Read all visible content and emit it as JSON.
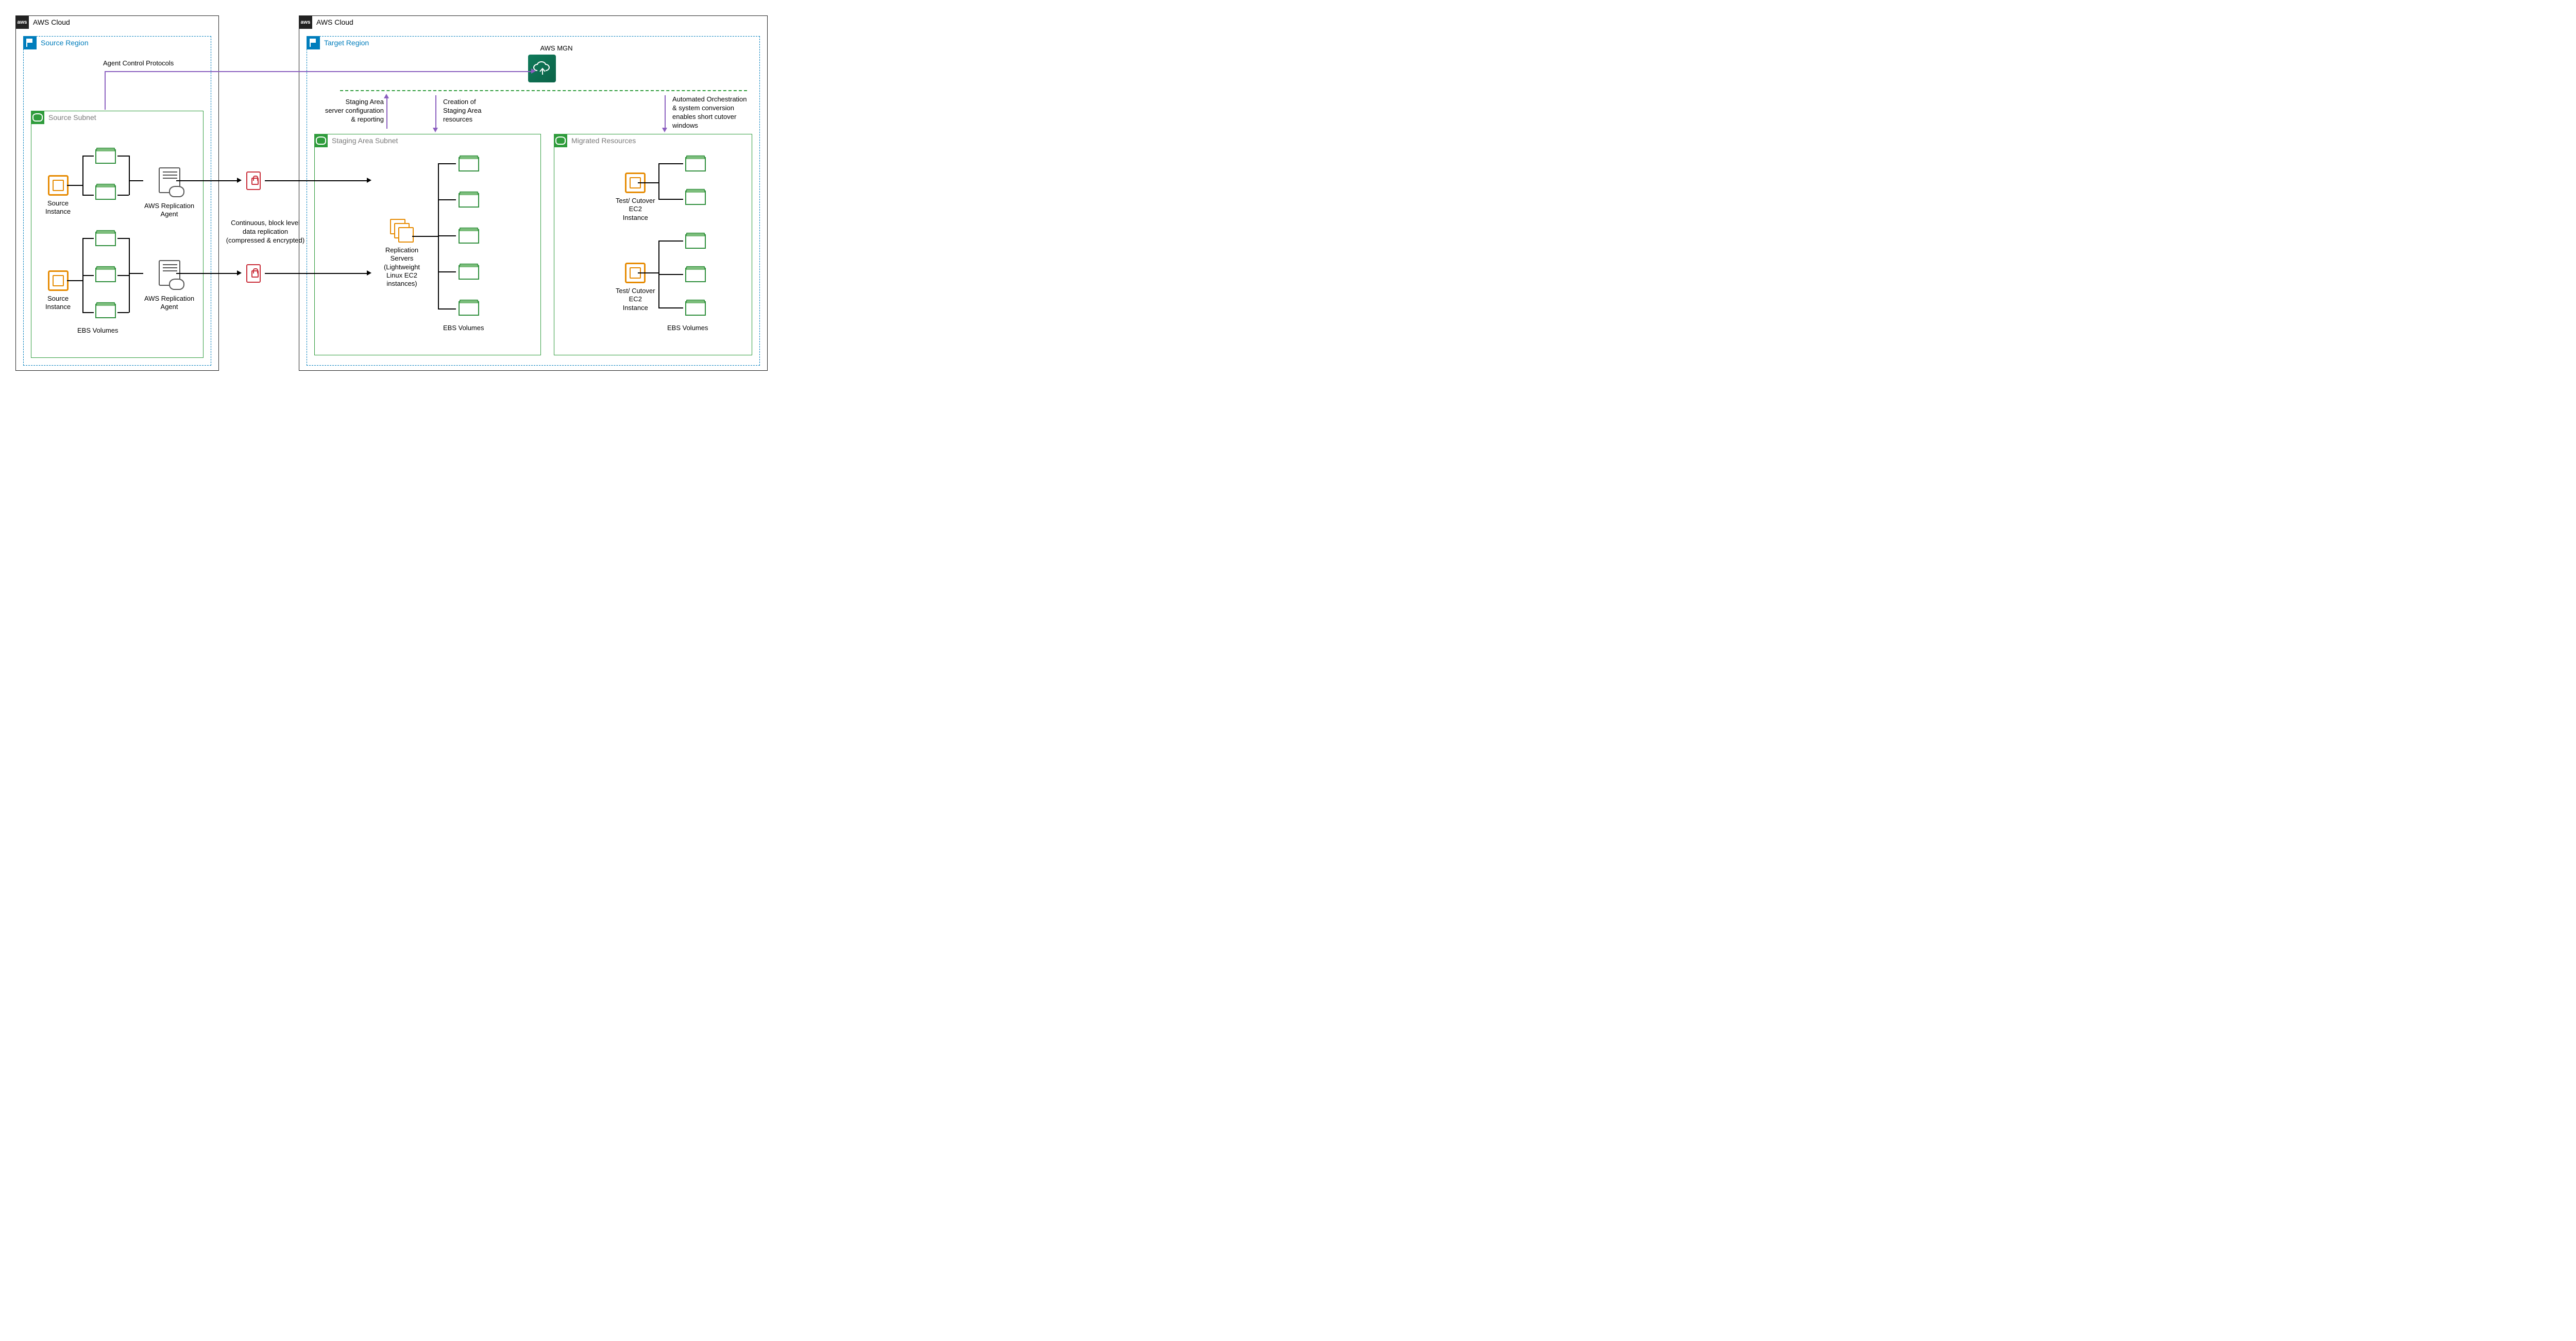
{
  "clouds": {
    "source_label": "AWS Cloud",
    "target_label": "AWS Cloud"
  },
  "regions": {
    "source_label": "Source Region",
    "target_label": "Target Region"
  },
  "subnets": {
    "source_label": "Source Subnet",
    "staging_label": "Staging Area Subnet",
    "migrated_label": "Migrated Resources"
  },
  "nodes": {
    "source_instance": "Source\nInstance",
    "ebs_volumes": "EBS Volumes",
    "replication_agent": "AWS Replication\nAgent",
    "replication_servers": "Replication\nServers\n(Lightweight\nLinux EC2\ninstances)",
    "test_cutover_instance": "Test/ Cutover\nEC2\nInstance",
    "mgn": "AWS MGN"
  },
  "labels": {
    "agent_control": "Agent Control Protocols",
    "replication": "Continuous, block level\ndata replication\n(compressed & encrypted)",
    "staging_reporting": "Staging Area\nserver configuration\n& reporting",
    "staging_creation": "Creation of\nStaging Area\nresources",
    "orchestration": "Automated Orchestration\n& system conversion\nenables short cutover\nwindows"
  },
  "icons": {
    "aws": "aws",
    "flag": "region-flag",
    "subnet": "subnet-cloud",
    "cpu": "ec2-instance",
    "volume": "ebs-volume",
    "agent": "replication-agent",
    "secure_file": "encrypted-file",
    "stack": "server-stack",
    "mgn": "aws-mgn-service"
  }
}
